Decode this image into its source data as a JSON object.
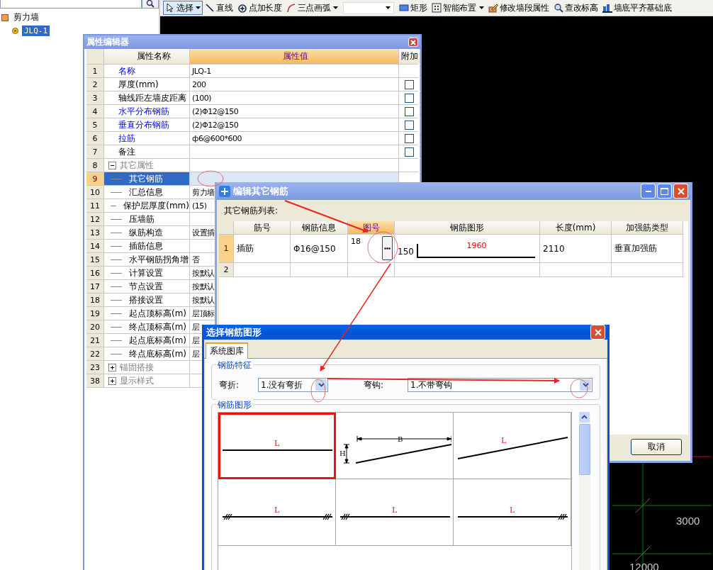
{
  "left_panel": {
    "tree": [
      {
        "label": "剪力墙",
        "children": [
          {
            "label": "JLQ-1",
            "selected": true
          }
        ]
      }
    ]
  },
  "toolbar": [
    {
      "kind": "button",
      "label": "选择",
      "selected": true,
      "dropdown": true
    },
    {
      "kind": "button",
      "label": "直线",
      "selected": false,
      "dropdown": false
    },
    {
      "kind": "button",
      "label": "点加长度",
      "selected": false,
      "dropdown": false
    },
    {
      "kind": "button",
      "label": "三点画弧",
      "selected": false,
      "dropdown": true
    },
    {
      "kind": "combo",
      "dropdown": true
    },
    {
      "kind": "button",
      "label": "矩形",
      "selected": false,
      "dropdown": false
    },
    {
      "kind": "button",
      "label": "智能布置",
      "selected": false,
      "dropdown": true
    },
    {
      "kind": "button",
      "label": "修改墙段属性",
      "selected": false,
      "dropdown": false
    },
    {
      "kind": "button",
      "label": "查改标高",
      "selected": false,
      "dropdown": false
    },
    {
      "kind": "button",
      "label": "墙底平齐基础底",
      "selected": false,
      "dropdown": false
    }
  ],
  "canvas": {
    "dimension_labels": [
      "3000",
      "12000"
    ]
  },
  "property_editor": {
    "title": "属性编辑器",
    "columns": [
      {
        "label": "属性名称",
        "selected": false
      },
      {
        "label": "属性值",
        "selected": true
      },
      {
        "label": "附加",
        "selected": false
      }
    ],
    "rows": [
      {
        "number": "1",
        "kind": "field",
        "name": "名称",
        "emphasis": true,
        "value": "JLQ-1",
        "selected": false
      },
      {
        "number": "2",
        "kind": "field",
        "name": "厚度(mm)",
        "emphasis": false,
        "value": "200",
        "selected": false,
        "checked": false
      },
      {
        "number": "3",
        "kind": "field",
        "name": "轴线距左墙皮距离",
        "emphasis": false,
        "value": "(100)",
        "selected": false,
        "checked": false
      },
      {
        "number": "4",
        "kind": "field",
        "name": "水平分布钢筋",
        "emphasis": true,
        "value": "(2)Φ12@150",
        "selected": false,
        "checked": false
      },
      {
        "number": "5",
        "kind": "field",
        "name": "垂直分布钢筋",
        "emphasis": true,
        "value": "(2)Φ12@150",
        "selected": false,
        "checked": false
      },
      {
        "number": "6",
        "kind": "field",
        "name": "拉筋",
        "emphasis": true,
        "value": "ф6@600*600",
        "selected": false,
        "checked": false
      },
      {
        "number": "7",
        "kind": "field",
        "name": "备注",
        "emphasis": false,
        "selected": false,
        "checked": false
      },
      {
        "number": "8",
        "kind": "group",
        "name": "其它属性",
        "expanded": true,
        "selected": false
      },
      {
        "number": "9",
        "kind": "child",
        "name": "其它钢筋",
        "emphasis": false,
        "selected": true
      },
      {
        "number": "10",
        "kind": "child",
        "name": "汇总信息",
        "emphasis": false,
        "value": "剪力墙",
        "selected": false
      },
      {
        "number": "11",
        "kind": "child",
        "name": "保护层厚度(mm)",
        "emphasis": false,
        "value": "(15)",
        "selected": false
      },
      {
        "number": "12",
        "kind": "child",
        "name": "压墙筋",
        "emphasis": false,
        "selected": false
      },
      {
        "number": "13",
        "kind": "child",
        "name": "纵筋构造",
        "emphasis": false,
        "value": "设置插",
        "selected": false
      },
      {
        "number": "14",
        "kind": "child",
        "name": "插筋信息",
        "emphasis": false,
        "selected": false
      },
      {
        "number": "15",
        "kind": "child",
        "name": "水平钢筋拐角增",
        "emphasis": false,
        "value": "否",
        "selected": false
      },
      {
        "number": "16",
        "kind": "child",
        "name": "计算设置",
        "emphasis": false,
        "value": "按默认",
        "selected": false
      },
      {
        "number": "17",
        "kind": "child",
        "name": "节点设置",
        "emphasis": false,
        "value": "按默认",
        "selected": false
      },
      {
        "number": "18",
        "kind": "child",
        "name": "搭接设置",
        "emphasis": false,
        "value": "按默认",
        "selected": false
      },
      {
        "number": "19",
        "kind": "child",
        "name": "起点顶标高(m)",
        "emphasis": false,
        "value": "层顶标",
        "selected": false
      },
      {
        "number": "20",
        "kind": "child",
        "name": "终点顶标高(m)",
        "emphasis": false,
        "value": "层",
        "selected": false
      },
      {
        "number": "21",
        "kind": "child",
        "name": "起点底标高(m)",
        "emphasis": false,
        "value": "层",
        "selected": false
      },
      {
        "number": "22",
        "kind": "child",
        "name": "终点底标高(m)",
        "emphasis": false,
        "value": "层",
        "selected": false
      },
      {
        "number": "23",
        "kind": "group",
        "name": "锚固搭接",
        "expanded": false,
        "selected": false
      },
      {
        "number": "38",
        "kind": "group",
        "name": "显示样式",
        "expanded": false,
        "selected": false
      }
    ]
  },
  "edit_rebar_dialog": {
    "title": "编辑其它钢筋",
    "list_label": "其它钢筋列表:",
    "columns": [
      {
        "label": "筋号",
        "selected": false
      },
      {
        "label": "钢筋信息",
        "selected": false
      },
      {
        "label": "图号",
        "selected": true
      },
      {
        "label": "钢筋图形",
        "selected": false
      },
      {
        "label": "长度(mm)",
        "selected": false
      },
      {
        "label": "加强筋类型",
        "selected": false
      }
    ],
    "rows": [
      {
        "number": "1",
        "selected": true,
        "bar_name": "插筋",
        "bar_info": "Φ16@150",
        "shape_no": "18",
        "shape": {
          "left_length": "150",
          "main_length": "1960"
        },
        "length": "2110",
        "type": "垂直加强筋"
      },
      {
        "number": "2",
        "selected": false
      }
    ],
    "buttons": [
      "取消"
    ]
  },
  "select_shape_dialog": {
    "title": "选择钢筋图形",
    "tabs": [
      {
        "label": "系统图库",
        "selected": true
      }
    ],
    "features": {
      "title": "钢筋特征",
      "fields": [
        {
          "label": "弯折:",
          "value": "1.没有弯折"
        },
        {
          "label": "弯钩:",
          "value": "1.不带弯钩"
        }
      ]
    },
    "shapes": {
      "title": "钢筋图形",
      "items": [
        {
          "kind": "straight",
          "selected": true,
          "labels": [
            "L"
          ]
        },
        {
          "kind": "sloped-dimensioned",
          "selected": false,
          "labels": [
            "B",
            "H"
          ]
        },
        {
          "kind": "sloped",
          "selected": false,
          "labels": [
            "L"
          ]
        },
        {
          "kind": "hooked-both",
          "selected": false,
          "labels": [
            "L"
          ]
        },
        {
          "kind": "hooked-left",
          "selected": false,
          "labels": [
            "L"
          ]
        },
        {
          "kind": "hooked-right",
          "selected": false,
          "labels": [
            "L"
          ]
        }
      ]
    }
  }
}
